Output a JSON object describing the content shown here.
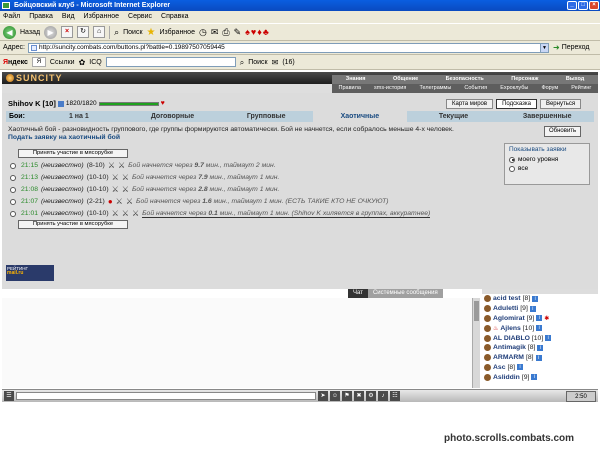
{
  "window": {
    "title": "Бойцовский клуб - Microsoft Internet Explorer"
  },
  "menu": {
    "items": [
      "Файл",
      "Правка",
      "Вид",
      "Избранное",
      "Сервис",
      "Справка"
    ]
  },
  "toolbar": {
    "back_label": "Назад",
    "search_label": "Поиск",
    "favorites_label": "Избранное"
  },
  "address": {
    "label": "Адрес:",
    "url": "http://suncity.combats.com/buttons.pl?battle=0.19897507059445",
    "go_label": "Переход"
  },
  "yandex": {
    "logo_prefix": "Я",
    "logo_rest": "ндекс",
    "links_label": "Ссылки",
    "icq_label": "ICQ",
    "search_label": "Поиск",
    "count_label": "(16)"
  },
  "game": {
    "logo": "SUNCITY",
    "topnav_row1": [
      "Знания",
      "Общение",
      "Безопасность",
      "Персонаж",
      "Выход"
    ],
    "topnav_row2": [
      "Правила",
      "sms-история",
      "Телеграммы",
      "События",
      "Ехроклубы",
      "Форум",
      "Рейтинг"
    ],
    "player": {
      "name": "Shihov K",
      "level": "[10]",
      "hp": "1820/1820",
      "hp_fraction": 1.0
    },
    "buttons": {
      "map": "Карта миров",
      "hint": "Подсказка",
      "back": "Вернуться",
      "refresh": "Обновить"
    },
    "tabs": {
      "lead": "Бои:",
      "items": [
        "1 на 1",
        "Договорные",
        "Групповые",
        "Хаотичные",
        "Текущие",
        "Завершенные"
      ],
      "active_index": 3
    },
    "description": "Хаотичный бой - разновидность группового, где группы формируются автоматически. Бой не начнется, если собралось меньше 4-х человек.",
    "apply_link": "Подать заявку на хаотичный бой",
    "show_box": {
      "title": "Показывать заявки",
      "options": [
        "моего уровня",
        "все"
      ],
      "selected": 0
    },
    "join_button": "Принять участие в мясорубке",
    "fights": [
      {
        "time": "21:15",
        "name": "(неизвестно)",
        "levels": "(8-10)",
        "info": "Бой начнется через",
        "minutes": "9.7",
        "rest": "мин., таймаут 2 мин."
      },
      {
        "time": "21:13",
        "name": "(неизвестно)",
        "levels": "(10-10)",
        "info": "Бой начнется через",
        "minutes": "7.9",
        "rest": "мин., таймаут 1 мин."
      },
      {
        "time": "21:08",
        "name": "(неизвестно)",
        "levels": "(10-10)",
        "info": "Бой начнется через",
        "minutes": "2.8",
        "rest": "мин., таймаут 1 мин."
      },
      {
        "time": "21:07",
        "name": "(неизвестно)",
        "levels": "(2-21)",
        "info": "Бой начнется через",
        "minutes": "1.6",
        "rest": "мин., таймаут 1 мин. (ЕСТЬ ТАКИЕ КТО НЕ ОЧКУЮТ)"
      },
      {
        "time": "21:01",
        "name": "(неизвестно)",
        "levels": "(10-10)",
        "info": "Бой начнется через",
        "minutes": "0.1",
        "rest": "мин., таймаут 1 мин. (Shihov K хиляется в группах, аккуратнее)"
      }
    ],
    "counter": {
      "line1": "РЕЙТИНГ",
      "line2": "mail.ru"
    }
  },
  "chat": {
    "tabs": [
      "Чат",
      "Системные сообщения"
    ],
    "active_tab": 0,
    "users": [
      {
        "name": "acid test",
        "level": "[8]"
      },
      {
        "name": "Aduletti",
        "level": "[9]"
      },
      {
        "name": "Aglomirat",
        "level": "[9]"
      },
      {
        "name": "Ajlens",
        "level": "[10]"
      },
      {
        "name": "AL DIABLO",
        "level": "[10]"
      },
      {
        "name": "Antimagik",
        "level": "[8]"
      },
      {
        "name": "ARMARM",
        "level": "[8]"
      },
      {
        "name": "Asc",
        "level": "[8]"
      },
      {
        "name": "Asliddin",
        "level": "[9]"
      }
    ],
    "clock": "2:50"
  },
  "watermark": "photo.scrolls.combats.com"
}
